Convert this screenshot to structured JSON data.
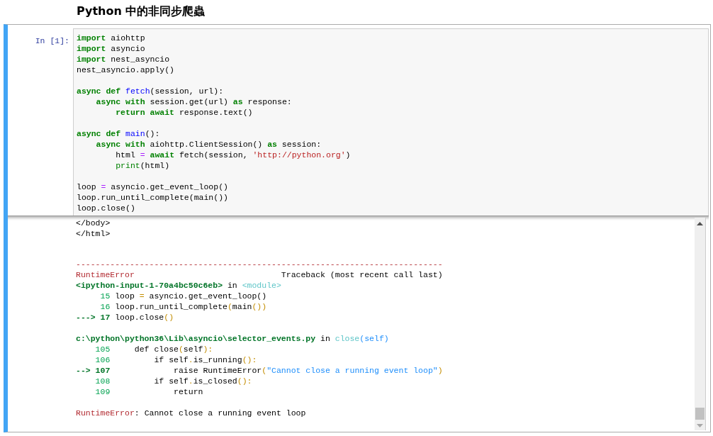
{
  "heading": "Python 中的非同步爬蟲",
  "cell": {
    "prompt": "In [1]:",
    "selected": true,
    "input_blocks": [
      [
        {
          "segments": [
            {
              "text": "import",
              "kind": "kw"
            },
            {
              "text": " aiohttp",
              "kind": "plain"
            }
          ]
        },
        {
          "segments": [
            {
              "text": "import",
              "kind": "kw"
            },
            {
              "text": " asyncio",
              "kind": "plain"
            }
          ]
        },
        {
          "segments": [
            {
              "text": "import",
              "kind": "kw"
            },
            {
              "text": " nest_asyncio",
              "kind": "plain"
            }
          ]
        },
        {
          "segments": [
            {
              "text": "nest_asyncio.apply()",
              "kind": "plain"
            }
          ]
        }
      ],
      [
        {
          "segments": [
            {
              "text": "async def",
              "kind": "kw"
            },
            {
              "text": " fetch",
              "kind": "fn"
            },
            {
              "text": "(session, url):",
              "kind": "plain"
            }
          ]
        },
        {
          "segments": [
            {
              "text": "    async with",
              "kind": "kw"
            },
            {
              "text": " session.get(url) ",
              "kind": "plain"
            },
            {
              "text": "as",
              "kind": "kw"
            },
            {
              "text": " response:",
              "kind": "plain"
            }
          ]
        },
        {
          "segments": [
            {
              "text": "        return await",
              "kind": "kw"
            },
            {
              "text": " response.text()",
              "kind": "plain"
            }
          ]
        }
      ],
      [
        {
          "segments": [
            {
              "text": "async def",
              "kind": "kw"
            },
            {
              "text": " main",
              "kind": "fn"
            },
            {
              "text": "():",
              "kind": "plain"
            }
          ]
        },
        {
          "segments": [
            {
              "text": "    async with",
              "kind": "kw"
            },
            {
              "text": " aiohttp.ClientSession() ",
              "kind": "plain"
            },
            {
              "text": "as",
              "kind": "kw"
            },
            {
              "text": " session:",
              "kind": "plain"
            }
          ]
        },
        {
          "segments": [
            {
              "text": "        html ",
              "kind": "plain"
            },
            {
              "text": "=",
              "kind": "op"
            },
            {
              "text": " await",
              "kind": "kw"
            },
            {
              "text": " fetch(session, ",
              "kind": "plain"
            },
            {
              "text": "'http://python.org'",
              "kind": "str"
            },
            {
              "text": ")",
              "kind": "plain"
            }
          ]
        },
        {
          "segments": [
            {
              "text": "        print",
              "kind": "builtin"
            },
            {
              "text": "(html)",
              "kind": "plain"
            }
          ]
        }
      ],
      [
        {
          "segments": [
            {
              "text": "loop ",
              "kind": "plain"
            },
            {
              "text": "=",
              "kind": "op"
            },
            {
              "text": " asyncio.get_event_loop()",
              "kind": "plain"
            }
          ]
        },
        {
          "segments": [
            {
              "text": "loop.run_until_complete(main())",
              "kind": "plain"
            }
          ]
        },
        {
          "segments": [
            {
              "text": "loop.close()",
              "kind": "plain"
            }
          ]
        }
      ]
    ],
    "stdout_lines": [
      "</body>",
      "</html>"
    ],
    "traceback_blocks": [
      [
        {
          "segments": [
            {
              "text": "---------------------------------------------------------------------------",
              "kind": "red"
            }
          ]
        },
        {
          "segments": [
            {
              "text": "RuntimeError",
              "kind": "red"
            },
            {
              "text": "                              Traceback (most recent call last)",
              "kind": "plain"
            }
          ]
        },
        {
          "segments": [
            {
              "text": "<ipython-input-1-70a4bc50c6eb>",
              "kind": "boldgreen"
            },
            {
              "text": " in ",
              "kind": "plain"
            },
            {
              "text": "<module>",
              "kind": "cyan"
            }
          ]
        },
        {
          "segments": [
            {
              "text": "     15",
              "kind": "green"
            },
            {
              "text": " loop ",
              "kind": "plain"
            },
            {
              "text": "=",
              "kind": "yellow"
            },
            {
              "text": " asyncio.get_event_loop()",
              "kind": "plain"
            }
          ]
        },
        {
          "segments": [
            {
              "text": "     16",
              "kind": "green"
            },
            {
              "text": " loop.run_until_complete",
              "kind": "plain"
            },
            {
              "text": "(",
              "kind": "yellow"
            },
            {
              "text": "main",
              "kind": "plain"
            },
            {
              "text": "())",
              "kind": "yellow"
            }
          ]
        },
        {
          "segments": [
            {
              "text": "---> 17",
              "kind": "boldgreen"
            },
            {
              "text": " loop.close",
              "kind": "plain"
            },
            {
              "text": "()",
              "kind": "yellow"
            }
          ]
        }
      ],
      [
        {
          "segments": [
            {
              "text": "c:\\python\\python36\\Lib\\asyncio\\selector_events.py",
              "kind": "boldgreen"
            },
            {
              "text": " in ",
              "kind": "plain"
            },
            {
              "text": "close",
              "kind": "cyan"
            },
            {
              "text": "(self)",
              "kind": "blue"
            }
          ]
        },
        {
          "segments": [
            {
              "text": "    105",
              "kind": "green"
            },
            {
              "text": "     def close",
              "kind": "plain"
            },
            {
              "text": "(",
              "kind": "yellow"
            },
            {
              "text": "self",
              "kind": "plain"
            },
            {
              "text": "):",
              "kind": "yellow"
            }
          ]
        },
        {
          "segments": [
            {
              "text": "    106",
              "kind": "green"
            },
            {
              "text": "         if self",
              "kind": "plain"
            },
            {
              "text": ".",
              "kind": "yellow"
            },
            {
              "text": "is_running",
              "kind": "plain"
            },
            {
              "text": "():",
              "kind": "yellow"
            }
          ]
        },
        {
          "segments": [
            {
              "text": "--> 107",
              "kind": "boldgreen"
            },
            {
              "text": "             raise RuntimeError",
              "kind": "plain"
            },
            {
              "text": "(",
              "kind": "yellow"
            },
            {
              "text": "\"Cannot close a running event loop\"",
              "kind": "blue"
            },
            {
              "text": ")",
              "kind": "yellow"
            }
          ]
        },
        {
          "segments": [
            {
              "text": "    108",
              "kind": "green"
            },
            {
              "text": "         if self",
              "kind": "plain"
            },
            {
              "text": ".",
              "kind": "yellow"
            },
            {
              "text": "is_closed",
              "kind": "plain"
            },
            {
              "text": "():",
              "kind": "yellow"
            }
          ]
        },
        {
          "segments": [
            {
              "text": "    109",
              "kind": "green"
            },
            {
              "text": "             return",
              "kind": "plain"
            }
          ]
        }
      ],
      [
        {
          "segments": [
            {
              "text": "RuntimeError",
              "kind": "red"
            },
            {
              "text": ": Cannot close a running event loop",
              "kind": "plain"
            }
          ]
        }
      ]
    ]
  }
}
